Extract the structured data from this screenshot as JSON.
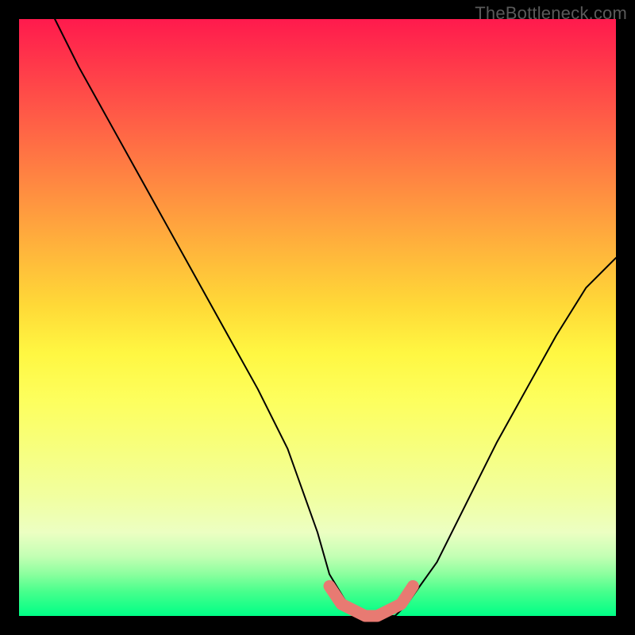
{
  "watermark": "TheBottleneck.com",
  "chart_data": {
    "type": "line",
    "title": "",
    "xlabel": "",
    "ylabel": "",
    "xlim": [
      0,
      100
    ],
    "ylim": [
      0,
      100
    ],
    "series": [
      {
        "name": "bottleneck-curve",
        "x": [
          6,
          10,
          15,
          20,
          25,
          30,
          35,
          40,
          45,
          50,
          52,
          55,
          58,
          60,
          63,
          65,
          70,
          75,
          80,
          85,
          90,
          95,
          100
        ],
        "values": [
          100,
          92,
          83,
          74,
          65,
          56,
          47,
          38,
          28,
          14,
          7,
          2,
          0,
          0,
          0,
          2,
          9,
          19,
          29,
          38,
          47,
          55,
          60
        ]
      },
      {
        "name": "optimal-zone",
        "x": [
          52,
          54,
          56,
          58,
          60,
          62,
          64,
          66
        ],
        "values": [
          5,
          2,
          1,
          0,
          0,
          1,
          2,
          5
        ]
      }
    ]
  }
}
